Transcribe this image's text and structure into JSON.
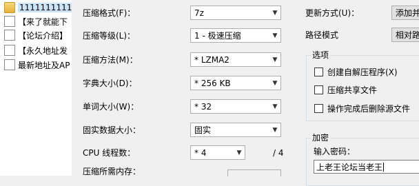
{
  "tree": {
    "items": [
      {
        "label": "1111111111",
        "type": "folder",
        "selected": true
      },
      {
        "label": "【来了就能下",
        "type": "file"
      },
      {
        "label": "【论坛介绍】",
        "type": "file"
      },
      {
        "label": "【永久地址发",
        "type": "file"
      },
      {
        "label": "最新地址及AP",
        "type": "file"
      }
    ]
  },
  "form": {
    "format": {
      "label": "压缩格式(F)：",
      "value": "7z"
    },
    "level": {
      "label": "压缩等级(L)：",
      "value": "1 - 极速压缩"
    },
    "method": {
      "label": "压缩方法(M)：",
      "value": "* LZMA2"
    },
    "dict": {
      "label": "字典大小(D)：",
      "value": "* 256 KB"
    },
    "word": {
      "label": "单词大小(W)：",
      "value": "* 32"
    },
    "solid": {
      "label": "固实数据大小：",
      "value": "固实"
    },
    "threads": {
      "label": "CPU 线程数：",
      "value": "* 4",
      "max": "/ 4"
    },
    "memory": {
      "label": "压缩所需内存："
    }
  },
  "right": {
    "update": {
      "label": "更新方式(U)：",
      "value": "添加并"
    },
    "path": {
      "label": "路径模式",
      "value": "相对路"
    },
    "options": {
      "title": "选项",
      "items": [
        {
          "label": "创建自解压程序(X)",
          "checked": false
        },
        {
          "label": "压缩共享文件",
          "checked": false
        },
        {
          "label": "操作完成后删除源文件",
          "checked": false
        }
      ]
    },
    "encryption": {
      "title": "加密",
      "password_label": "输入密码：",
      "password_value": "上老王论坛当老王"
    }
  },
  "icons": {
    "dropdown": "chevron-down-icon",
    "folder": "folder-icon",
    "file": "file-icon"
  }
}
